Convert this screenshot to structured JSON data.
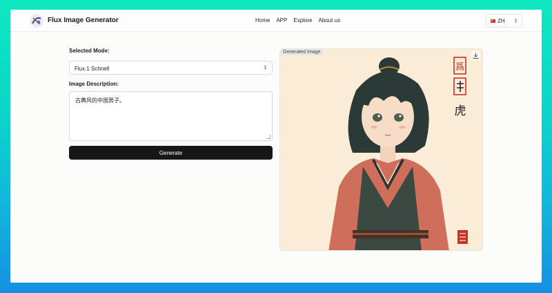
{
  "app": {
    "brand": "Flux Image Generator",
    "nav": [
      "Home",
      "APP",
      "Explore",
      "About us"
    ],
    "language": "ZH"
  },
  "form": {
    "mode_label": "Selected Mode:",
    "mode_value": "Flux.1 Schnell",
    "description_label": "Image Description:",
    "description_value": "古典风的中国男子。",
    "generate_label": "Generate"
  },
  "output": {
    "tag": "Generated Image",
    "seal_text_top": "爲",
    "calligraphy": "虎"
  },
  "icons": {
    "logo": "flux-logo-icon",
    "download": "download-icon",
    "select": "chevron-updown-icon"
  },
  "colors": {
    "accent": "#161716",
    "gradient_top": "#0ee8c0",
    "gradient_bottom": "#1690e4",
    "panel_bg": "#fbecd8",
    "seal_red": "#c8322b"
  }
}
